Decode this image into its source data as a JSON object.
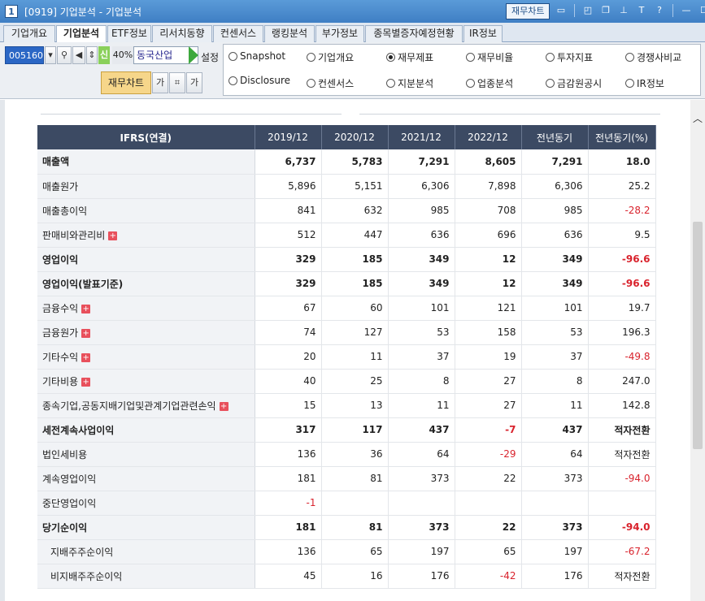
{
  "window": {
    "number": "1",
    "title": "[0919] 기업분석 - 기업분석",
    "fin_chart_button": "재무차트"
  },
  "tabs": [
    {
      "label": "기업개요",
      "active": false
    },
    {
      "label": "기업분석",
      "active": true
    },
    {
      "label": "ETF정보",
      "active": false
    },
    {
      "label": "리서치동향",
      "active": false
    },
    {
      "label": "컨센서스",
      "active": false
    },
    {
      "label": "랭킹분석",
      "active": false
    },
    {
      "label": "부가정보",
      "active": false
    },
    {
      "label": "종목별증자예정현황",
      "active": false
    },
    {
      "label": "IR정보",
      "active": false
    }
  ],
  "toolbar": {
    "stock_code": "005160",
    "credit_label": "신",
    "margin_pct": "40%",
    "company_name": "동국산업",
    "setting_label": "설정",
    "fin_statement_button": "재무차트",
    "font_up_label": "가",
    "font_down_label": "가"
  },
  "radios": [
    {
      "label": "Snapshot",
      "checked": false
    },
    {
      "label": "기업개요",
      "checked": false
    },
    {
      "label": "재무제표",
      "checked": true
    },
    {
      "label": "재무비율",
      "checked": false
    },
    {
      "label": "투자지표",
      "checked": false
    },
    {
      "label": "경쟁사비교",
      "checked": false
    },
    {
      "label": "Disclosure",
      "checked": false
    },
    {
      "label": "컨센서스",
      "checked": false
    },
    {
      "label": "지분분석",
      "checked": false
    },
    {
      "label": "업종분석",
      "checked": false
    },
    {
      "label": "금감원공시",
      "checked": false
    },
    {
      "label": "IR정보",
      "checked": false
    }
  ],
  "table": {
    "headers": [
      "IFRS(연결)",
      "2019/12",
      "2020/12",
      "2021/12",
      "2022/12",
      "전년동기",
      "전년동기(%)"
    ],
    "rows": [
      {
        "label": "매출액",
        "bold": true,
        "expand": false,
        "indent": false,
        "values": [
          "6,737",
          "5,783",
          "7,291",
          "8,605",
          "7,291",
          "18.0"
        ]
      },
      {
        "label": "매출원가",
        "bold": false,
        "expand": false,
        "indent": false,
        "values": [
          "5,896",
          "5,151",
          "6,306",
          "7,898",
          "6,306",
          "25.2"
        ]
      },
      {
        "label": "매출총이익",
        "bold": false,
        "expand": false,
        "indent": false,
        "values": [
          "841",
          "632",
          "985",
          "708",
          "985",
          "-28.2"
        ]
      },
      {
        "label": "판매비와관리비",
        "bold": false,
        "expand": true,
        "indent": false,
        "values": [
          "512",
          "447",
          "636",
          "696",
          "636",
          "9.5"
        ]
      },
      {
        "label": "영업이익",
        "bold": true,
        "expand": false,
        "indent": false,
        "values": [
          "329",
          "185",
          "349",
          "12",
          "349",
          "-96.6"
        ]
      },
      {
        "label": "영업이익(발표기준)",
        "bold": true,
        "expand": false,
        "indent": false,
        "values": [
          "329",
          "185",
          "349",
          "12",
          "349",
          "-96.6"
        ]
      },
      {
        "label": "금융수익",
        "bold": false,
        "expand": true,
        "indent": false,
        "values": [
          "67",
          "60",
          "101",
          "121",
          "101",
          "19.7"
        ]
      },
      {
        "label": "금융원가",
        "bold": false,
        "expand": true,
        "indent": false,
        "values": [
          "74",
          "127",
          "53",
          "158",
          "53",
          "196.3"
        ]
      },
      {
        "label": "기타수익",
        "bold": false,
        "expand": true,
        "indent": false,
        "values": [
          "20",
          "11",
          "37",
          "19",
          "37",
          "-49.8"
        ]
      },
      {
        "label": "기타비용",
        "bold": false,
        "expand": true,
        "indent": false,
        "values": [
          "40",
          "25",
          "8",
          "27",
          "8",
          "247.0"
        ]
      },
      {
        "label": "종속기업,공동지배기업및관계기업관련손익",
        "bold": false,
        "expand": true,
        "indent": false,
        "values": [
          "15",
          "13",
          "11",
          "27",
          "11",
          "142.8"
        ]
      },
      {
        "label": "세전계속사업이익",
        "bold": true,
        "expand": false,
        "indent": false,
        "values": [
          "317",
          "117",
          "437",
          "-7",
          "437",
          "적자전환"
        ]
      },
      {
        "label": "법인세비용",
        "bold": false,
        "expand": false,
        "indent": false,
        "values": [
          "136",
          "36",
          "64",
          "-29",
          "64",
          "적자전환"
        ]
      },
      {
        "label": "계속영업이익",
        "bold": false,
        "expand": false,
        "indent": false,
        "values": [
          "181",
          "81",
          "373",
          "22",
          "373",
          "-94.0"
        ]
      },
      {
        "label": "중단영업이익",
        "bold": false,
        "expand": false,
        "indent": false,
        "values": [
          "-1",
          "",
          "",
          "",
          "",
          ""
        ]
      },
      {
        "label": "당기순이익",
        "bold": true,
        "expand": false,
        "indent": false,
        "values": [
          "181",
          "81",
          "373",
          "22",
          "373",
          "-94.0"
        ]
      },
      {
        "label": "지배주주순이익",
        "bold": false,
        "expand": false,
        "indent": true,
        "values": [
          "136",
          "65",
          "197",
          "65",
          "197",
          "-67.2"
        ]
      },
      {
        "label": "비지배주주순이익",
        "bold": false,
        "expand": false,
        "indent": true,
        "values": [
          "45",
          "16",
          "176",
          "-42",
          "176",
          "적자전환"
        ]
      }
    ]
  },
  "colors": {
    "negative": "#d9232d",
    "header_bg": "#3c4a63",
    "title_bar": "#3f7fc4"
  }
}
